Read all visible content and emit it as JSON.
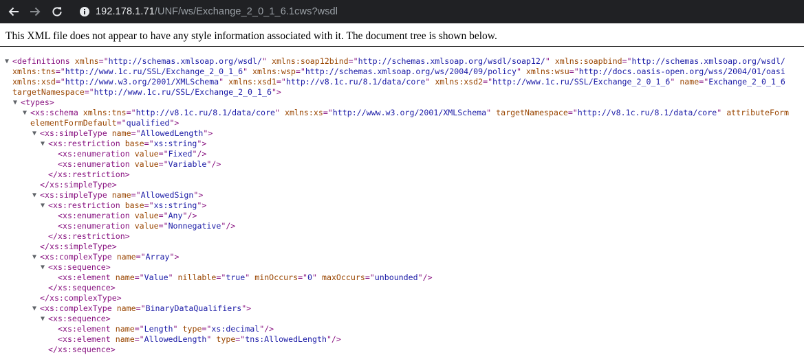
{
  "browser": {
    "url_host": "192.178.1.71",
    "url_path": "/UNF/ws/Exchange_2_0_1_6.1cws?wsdl"
  },
  "banner_text": "This XML file does not appear to have any style information associated with it. The document tree is shown below.",
  "xml_lines": [
    {
      "indent": 0,
      "toggle": true,
      "tokens": [
        [
          "p",
          "<definitions "
        ],
        [
          "an",
          "xmlns"
        ],
        [
          "p",
          "=\""
        ],
        [
          "av",
          "http://schemas.xmlsoap.org/wsdl/"
        ],
        [
          "p",
          "\" "
        ],
        [
          "an",
          "xmlns:soap12bind"
        ],
        [
          "p",
          "=\""
        ],
        [
          "av",
          "http://schemas.xmlsoap.org/wsdl/soap12/"
        ],
        [
          "p",
          "\" "
        ],
        [
          "an",
          "xmlns:soapbind"
        ],
        [
          "p",
          "=\""
        ],
        [
          "av",
          "http://schemas.xmlsoap.org/wsdl/"
        ]
      ]
    },
    {
      "indent": 1,
      "toggle": false,
      "tokens": [
        [
          "an",
          "xmlns:tns"
        ],
        [
          "p",
          "=\""
        ],
        [
          "av",
          "http://www.1c.ru/SSL/Exchange_2_0_1_6"
        ],
        [
          "p",
          "\" "
        ],
        [
          "an",
          "xmlns:wsp"
        ],
        [
          "p",
          "=\""
        ],
        [
          "av",
          "http://schemas.xmlsoap.org/ws/2004/09/policy"
        ],
        [
          "p",
          "\" "
        ],
        [
          "an",
          "xmlns:wsu"
        ],
        [
          "p",
          "=\""
        ],
        [
          "av",
          "http://docs.oasis-open.org/wss/2004/01/oasi"
        ]
      ]
    },
    {
      "indent": 1,
      "toggle": false,
      "tokens": [
        [
          "an",
          "xmlns:xsd"
        ],
        [
          "p",
          "=\""
        ],
        [
          "av",
          "http://www.w3.org/2001/XMLSchema"
        ],
        [
          "p",
          "\" "
        ],
        [
          "an",
          "xmlns:xsd1"
        ],
        [
          "p",
          "=\""
        ],
        [
          "av",
          "http://v8.1c.ru/8.1/data/core"
        ],
        [
          "p",
          "\" "
        ],
        [
          "an",
          "xmlns:xsd2"
        ],
        [
          "p",
          "=\""
        ],
        [
          "av",
          "http://www.1c.ru/SSL/Exchange_2_0_1_6"
        ],
        [
          "p",
          "\" "
        ],
        [
          "an",
          "name"
        ],
        [
          "p",
          "=\""
        ],
        [
          "av",
          "Exchange_2_0_1_6"
        ]
      ]
    },
    {
      "indent": 1,
      "toggle": false,
      "tokens": [
        [
          "an",
          "targetNamespace"
        ],
        [
          "p",
          "=\""
        ],
        [
          "av",
          "http://www.1c.ru/SSL/Exchange_2_0_1_6"
        ],
        [
          "p",
          "\">"
        ]
      ]
    },
    {
      "indent": 2,
      "toggle": true,
      "tokens": [
        [
          "p",
          "<types>"
        ]
      ]
    },
    {
      "indent": 3,
      "toggle": true,
      "tokens": [
        [
          "p",
          "<xs:schema "
        ],
        [
          "an",
          "xmlns:tns"
        ],
        [
          "p",
          "=\""
        ],
        [
          "av",
          "http://v8.1c.ru/8.1/data/core"
        ],
        [
          "p",
          "\" "
        ],
        [
          "an",
          "xmlns:xs"
        ],
        [
          "p",
          "=\""
        ],
        [
          "av",
          "http://www.w3.org/2001/XMLSchema"
        ],
        [
          "p",
          "\" "
        ],
        [
          "an",
          "targetNamespace"
        ],
        [
          "p",
          "=\""
        ],
        [
          "av",
          "http://v8.1c.ru/8.1/data/core"
        ],
        [
          "p",
          "\" "
        ],
        [
          "an",
          "attributeForm"
        ]
      ]
    },
    {
      "indent": 4,
      "toggle": false,
      "tokens": [
        [
          "an",
          "elementFormDefault"
        ],
        [
          "p",
          "=\""
        ],
        [
          "av",
          "qualified"
        ],
        [
          "p",
          "\">"
        ]
      ]
    },
    {
      "indent": 5,
      "toggle": true,
      "tokens": [
        [
          "p",
          "<xs:simpleType "
        ],
        [
          "an",
          "name"
        ],
        [
          "p",
          "=\""
        ],
        [
          "av",
          "AllowedLength"
        ],
        [
          "p",
          "\">"
        ]
      ]
    },
    {
      "indent": 6,
      "toggle": true,
      "tokens": [
        [
          "p",
          "<xs:restriction "
        ],
        [
          "an",
          "base"
        ],
        [
          "p",
          "=\""
        ],
        [
          "av",
          "xs:string"
        ],
        [
          "p",
          "\">"
        ]
      ]
    },
    {
      "indent": 7,
      "toggle": false,
      "tokens": [
        [
          "p",
          "<xs:enumeration "
        ],
        [
          "an",
          "value"
        ],
        [
          "p",
          "=\""
        ],
        [
          "av",
          "Fixed"
        ],
        [
          "p",
          "\"/>"
        ]
      ]
    },
    {
      "indent": 7,
      "toggle": false,
      "tokens": [
        [
          "p",
          "<xs:enumeration "
        ],
        [
          "an",
          "value"
        ],
        [
          "p",
          "=\""
        ],
        [
          "av",
          "Variable"
        ],
        [
          "p",
          "\"/>"
        ]
      ]
    },
    {
      "indent": 6,
      "toggle": false,
      "tokens": [
        [
          "p",
          "</xs:restriction>"
        ]
      ]
    },
    {
      "indent": 5,
      "toggle": false,
      "tokens": [
        [
          "p",
          "</xs:simpleType>"
        ]
      ]
    },
    {
      "indent": 5,
      "toggle": true,
      "tokens": [
        [
          "p",
          "<xs:simpleType "
        ],
        [
          "an",
          "name"
        ],
        [
          "p",
          "=\""
        ],
        [
          "av",
          "AllowedSign"
        ],
        [
          "p",
          "\">"
        ]
      ]
    },
    {
      "indent": 6,
      "toggle": true,
      "tokens": [
        [
          "p",
          "<xs:restriction "
        ],
        [
          "an",
          "base"
        ],
        [
          "p",
          "=\""
        ],
        [
          "av",
          "xs:string"
        ],
        [
          "p",
          "\">"
        ]
      ]
    },
    {
      "indent": 7,
      "toggle": false,
      "tokens": [
        [
          "p",
          "<xs:enumeration "
        ],
        [
          "an",
          "value"
        ],
        [
          "p",
          "=\""
        ],
        [
          "av",
          "Any"
        ],
        [
          "p",
          "\"/>"
        ]
      ]
    },
    {
      "indent": 7,
      "toggle": false,
      "tokens": [
        [
          "p",
          "<xs:enumeration "
        ],
        [
          "an",
          "value"
        ],
        [
          "p",
          "=\""
        ],
        [
          "av",
          "Nonnegative"
        ],
        [
          "p",
          "\"/>"
        ]
      ]
    },
    {
      "indent": 6,
      "toggle": false,
      "tokens": [
        [
          "p",
          "</xs:restriction>"
        ]
      ]
    },
    {
      "indent": 5,
      "toggle": false,
      "tokens": [
        [
          "p",
          "</xs:simpleType>"
        ]
      ]
    },
    {
      "indent": 5,
      "toggle": true,
      "tokens": [
        [
          "p",
          "<xs:complexType "
        ],
        [
          "an",
          "name"
        ],
        [
          "p",
          "=\""
        ],
        [
          "av",
          "Array"
        ],
        [
          "p",
          "\">"
        ]
      ]
    },
    {
      "indent": 6,
      "toggle": true,
      "tokens": [
        [
          "p",
          "<xs:sequence>"
        ]
      ]
    },
    {
      "indent": 7,
      "toggle": false,
      "tokens": [
        [
          "p",
          "<xs:element "
        ],
        [
          "an",
          "name"
        ],
        [
          "p",
          "=\""
        ],
        [
          "av",
          "Value"
        ],
        [
          "p",
          "\" "
        ],
        [
          "an",
          "nillable"
        ],
        [
          "p",
          "=\""
        ],
        [
          "av",
          "true"
        ],
        [
          "p",
          "\" "
        ],
        [
          "an",
          "minOccurs"
        ],
        [
          "p",
          "=\""
        ],
        [
          "av",
          "0"
        ],
        [
          "p",
          "\" "
        ],
        [
          "an",
          "maxOccurs"
        ],
        [
          "p",
          "=\""
        ],
        [
          "av",
          "unbounded"
        ],
        [
          "p",
          "\"/>"
        ]
      ]
    },
    {
      "indent": 6,
      "toggle": false,
      "tokens": [
        [
          "p",
          "</xs:sequence>"
        ]
      ]
    },
    {
      "indent": 5,
      "toggle": false,
      "tokens": [
        [
          "p",
          "</xs:complexType>"
        ]
      ]
    },
    {
      "indent": 5,
      "toggle": true,
      "tokens": [
        [
          "p",
          "<xs:complexType "
        ],
        [
          "an",
          "name"
        ],
        [
          "p",
          "=\""
        ],
        [
          "av",
          "BinaryDataQualifiers"
        ],
        [
          "p",
          "\">"
        ]
      ]
    },
    {
      "indent": 6,
      "toggle": true,
      "tokens": [
        [
          "p",
          "<xs:sequence>"
        ]
      ]
    },
    {
      "indent": 7,
      "toggle": false,
      "tokens": [
        [
          "p",
          "<xs:element "
        ],
        [
          "an",
          "name"
        ],
        [
          "p",
          "=\""
        ],
        [
          "av",
          "Length"
        ],
        [
          "p",
          "\" "
        ],
        [
          "an",
          "type"
        ],
        [
          "p",
          "=\""
        ],
        [
          "av",
          "xs:decimal"
        ],
        [
          "p",
          "\"/>"
        ]
      ]
    },
    {
      "indent": 7,
      "toggle": false,
      "tokens": [
        [
          "p",
          "<xs:element "
        ],
        [
          "an",
          "name"
        ],
        [
          "p",
          "=\""
        ],
        [
          "av",
          "AllowedLength"
        ],
        [
          "p",
          "\" "
        ],
        [
          "an",
          "type"
        ],
        [
          "p",
          "=\""
        ],
        [
          "av",
          "tns:AllowedLength"
        ],
        [
          "p",
          "\"/>"
        ]
      ]
    },
    {
      "indent": 6,
      "toggle": false,
      "tokens": [
        [
          "p",
          "</xs:sequence>"
        ]
      ]
    }
  ]
}
